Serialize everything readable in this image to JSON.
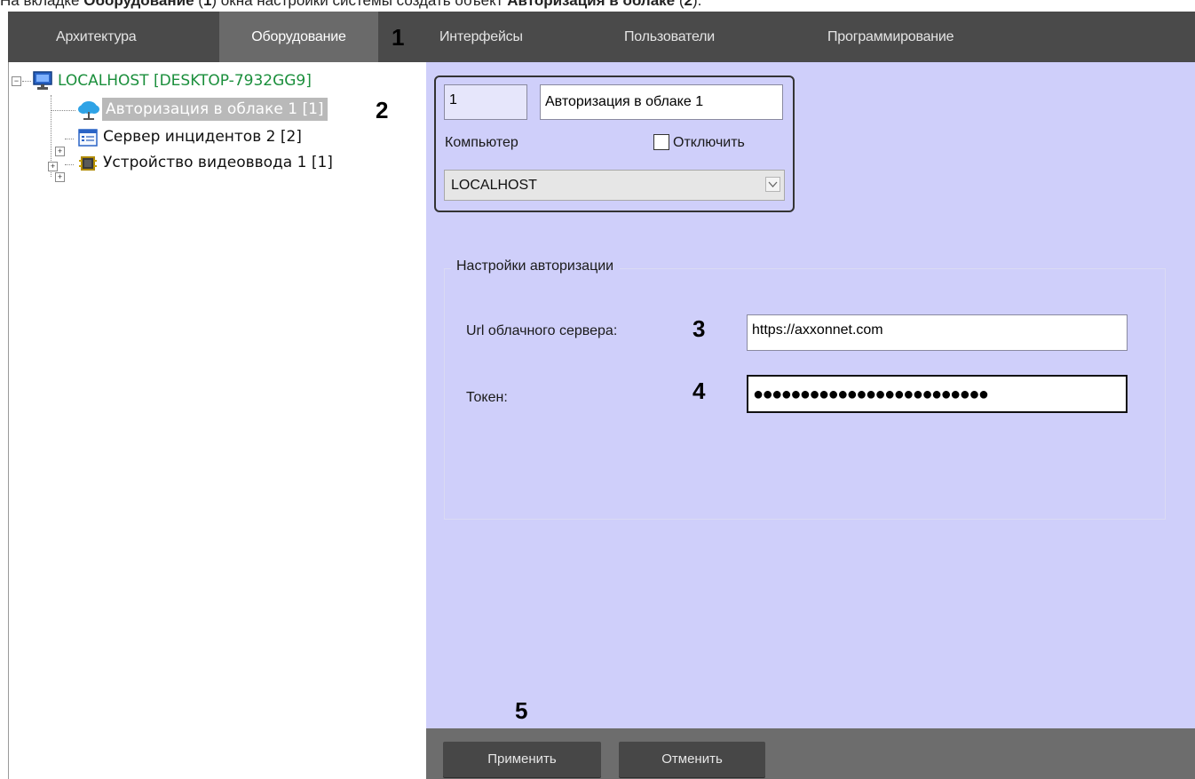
{
  "caption": {
    "prefix": "На вкладке ",
    "bold1": "Оборудование",
    "mid1": " (",
    "num1": "1",
    "mid2": ") окна настройки системы создать объект ",
    "bold2": "Авторизация в облаке",
    "mid3": " (",
    "num2": "2",
    "suffix": ")."
  },
  "tabs": [
    {
      "label": "Архитектура",
      "active": false
    },
    {
      "label": "Оборудование",
      "active": true
    },
    {
      "label": "Интерфейсы",
      "active": false
    },
    {
      "label": "Пользователи",
      "active": false
    },
    {
      "label": "Программирование",
      "active": false
    }
  ],
  "markers": {
    "m1": "1",
    "m2": "2",
    "m3": "3",
    "m4": "4",
    "m5": "5"
  },
  "tree": {
    "root": {
      "label": "LOCALHOST [DESKTOP-7932GG9]",
      "color": "#1b8f3c",
      "expander": "−",
      "icon": "monitor-icon"
    },
    "items": [
      {
        "label": "Авторизация в облаке 1 [1]",
        "selected": true,
        "icon": "cloud-icon"
      },
      {
        "label": "Сервер инцидентов 2 [2]",
        "selected": false,
        "expander": "+",
        "icon": "server-icon"
      },
      {
        "label": "Устройство видеоввода 1 [1]",
        "selected": false,
        "expander": "+",
        "icon": "chip-icon"
      }
    ]
  },
  "object": {
    "id_value": "1",
    "name_value": "Авторизация в облаке 1",
    "computer_label": "Компьютер",
    "disable_label": "Отключить",
    "disable_checked": false,
    "computer_value": "LOCALHOST"
  },
  "settings": {
    "group_title": "Настройки авторизации",
    "url_label": "Url облачного сервера:",
    "url_value": "https://axxonnet.com",
    "token_label": "Токен:",
    "token_value": "●●●●●●●●●●●●●●●●●●●●●●●●●"
  },
  "buttons": {
    "apply": "Применить",
    "cancel": "Отменить"
  },
  "colors": {
    "tabbar": "#4a4a4a",
    "tab_active": "#6a6a6a",
    "panel": "#cfcffa",
    "bottombar": "#6d6d6d",
    "button": "#474747",
    "root_green": "#1b8f3c",
    "selected_bg": "#b9b9b9"
  }
}
